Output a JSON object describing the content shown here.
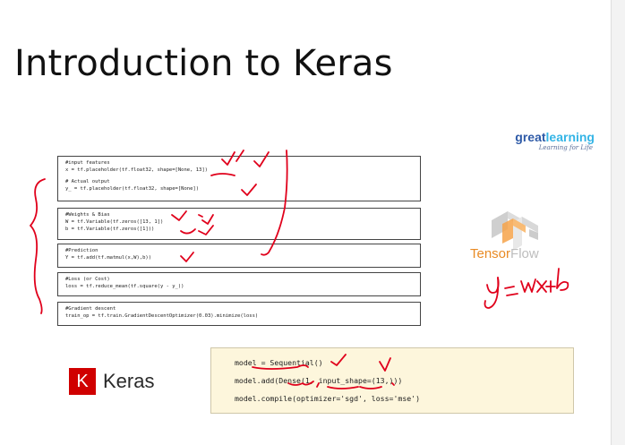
{
  "slide": {
    "title": "Introduction to Keras"
  },
  "greatlearning_logo": {
    "great": "great",
    "learning": "learning",
    "tagline": "Learning for Life",
    "brand_color_dark": "#2e5aa7",
    "brand_color_light": "#35b5e6"
  },
  "code_blocks": [
    {
      "lines": [
        "#input features",
        "x = tf.placeholder(tf.float32, shape=[None, 13])",
        "",
        "# Actual output",
        "y_ = tf.placeholder(tf.float32, shape=[None])"
      ]
    },
    {
      "lines": [
        "#Weights & Bias",
        "W = tf.Variable(tf.zeros([13, 1])",
        "b = tf.Variable(tf.zeros([1]))"
      ]
    },
    {
      "lines": [
        "#Prediction",
        "Y = tf.add(tf.matmul(x,W),b))"
      ]
    },
    {
      "lines": [
        "#Loss (or Cost)",
        "loss = tf.reduce_mean(tf.square(y - y_))"
      ]
    },
    {
      "lines": [
        "#Gradient descent",
        "train_op = tf.train.GradientDescentOptimizer(0.03).minimize(loss)"
      ]
    }
  ],
  "tensorflow_logo": {
    "tensor": "Tensor",
    "flow": "Flow",
    "icon": "tensorflow-icon",
    "brand_color": "#e98b25"
  },
  "keras_logo": {
    "letter": "K",
    "word": "Keras",
    "brand_color": "#d00000",
    "icon": "keras-icon"
  },
  "keras_code": {
    "lines": [
      "model = Sequential()",
      "model.add(Dense(1, input_shape=(13,)))",
      "model.compile(optimizer='sgd', loss='mse')"
    ]
  },
  "annotations": {
    "handwritten_formula": "y = wx + b",
    "ink_color": "#e0001b"
  }
}
